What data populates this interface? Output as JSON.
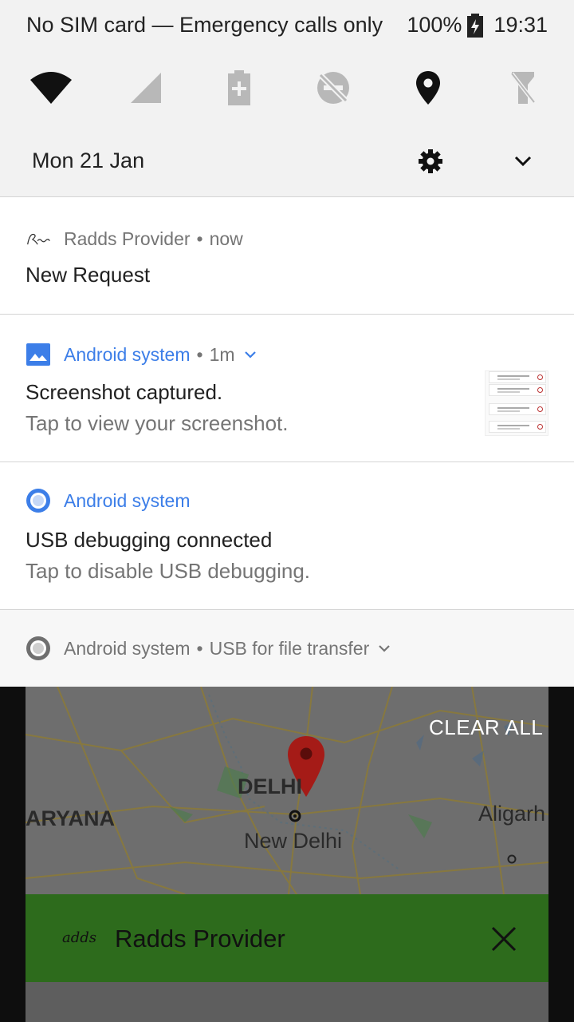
{
  "status_bar": {
    "carrier_text": "No SIM card — Emergency calls only",
    "battery_percent": "100%",
    "time": "19:31"
  },
  "quick_settings": {
    "tiles": [
      "wifi-icon",
      "cell-signal-icon",
      "battery-saver-icon",
      "do-not-disturb-icon",
      "location-icon",
      "flashlight-icon"
    ]
  },
  "date_row": {
    "date": "Mon 21 Jan"
  },
  "notifications": [
    {
      "app": "Radds Provider",
      "dot": "•",
      "time": "now",
      "title": "New Request",
      "icon": "radds-logo-icon"
    },
    {
      "app": "Android system",
      "dot": "•",
      "time": "1m",
      "title": "Screenshot captured.",
      "text": "Tap to view your screenshot.",
      "icon": "image-icon"
    },
    {
      "app": "Android system",
      "title": "USB debugging connected",
      "text": "Tap to disable USB debugging.",
      "icon": "android-system-icon"
    },
    {
      "app": "Android system",
      "dot": "•",
      "detail": "USB for file transfer",
      "icon": "android-system-icon"
    }
  ],
  "background_app": {
    "clear_all": "CLEAR ALL",
    "map_labels": {
      "delhi": "DELHI",
      "haryana": "ARYANA",
      "new_delhi": "New Delhi",
      "aligarh": "Aligarh"
    },
    "app_bar_logo": "adds",
    "app_bar_title": "Radds Provider"
  },
  "colors": {
    "accent_blue": "#3c7ee8",
    "app_bar_green": "#2d6b1c",
    "map_pin_red": "#c0221b"
  }
}
